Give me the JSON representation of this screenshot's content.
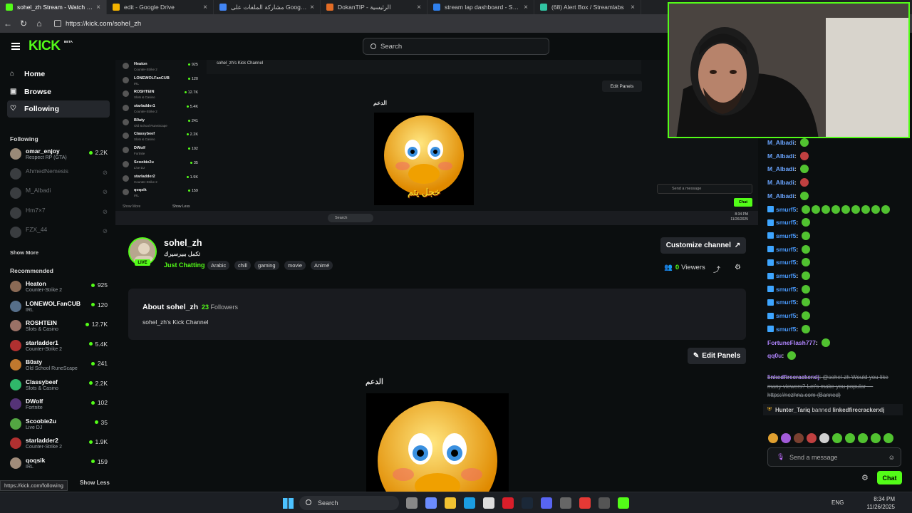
{
  "browser": {
    "tabs": [
      {
        "title": "sohel_zh Stream - Watch Live on",
        "fav": "#53fc18"
      },
      {
        "title": "edit - Google Drive",
        "fav": "#f4b400"
      },
      {
        "title": "مشاركة الملفات على Google Drive",
        "fav": "#4285f4"
      },
      {
        "title": "DokanTIP - الرئيسية",
        "fav": "#e36c25"
      },
      {
        "title": "stream lap dashboard - Search",
        "fav": "#2f80ed"
      },
      {
        "title": "(68) Alert Box / Streamlabs",
        "fav": "#31c3a2"
      }
    ],
    "url": "https://kick.com/sohel_zh",
    "status_url": "https://kick.com/following"
  },
  "header": {
    "logo": "KICK",
    "beta": "BETA",
    "search_placeholder": "Search"
  },
  "sidebar": {
    "nav": [
      "Home",
      "Browse",
      "Following"
    ],
    "following_title": "Following",
    "following": [
      {
        "name": "omar_enjoy",
        "sub": "Respect RP (GTA)",
        "viewers": "2.2K",
        "live": true
      },
      {
        "name": "AhmedNemesis",
        "sub": "",
        "viewers": "",
        "live": false
      },
      {
        "name": "M_Albadi",
        "sub": "",
        "viewers": "",
        "live": false
      },
      {
        "name": "Hm7×7",
        "sub": "",
        "viewers": "",
        "live": false
      },
      {
        "name": "FZX_44",
        "sub": "",
        "viewers": "",
        "live": false
      }
    ],
    "show_more": "Show More",
    "recommended_title": "Recommended",
    "recommended": [
      {
        "name": "Heaton",
        "sub": "Counter-Strike 2",
        "viewers": "925",
        "color": "#8a6a55"
      },
      {
        "name": "LONEWOLFanCUB",
        "sub": "IRL",
        "viewers": "120",
        "color": "#566f8a"
      },
      {
        "name": "ROSHTEIN",
        "sub": "Slots & Casino",
        "viewers": "12.7K",
        "color": "#9a7166"
      },
      {
        "name": "starladder1",
        "sub": "Counter-Strike 2",
        "viewers": "5.4K",
        "color": "#b03030"
      },
      {
        "name": "B0aty",
        "sub": "Old School RuneScape",
        "viewers": "241",
        "color": "#c0782e"
      },
      {
        "name": "Classybeef",
        "sub": "Slots & Casino",
        "viewers": "2.2K",
        "color": "#2fb86a"
      },
      {
        "name": "DWolf",
        "sub": "Fortnite",
        "viewers": "102",
        "color": "#553377"
      },
      {
        "name": "Scoobie2u",
        "sub": "Live DJ",
        "viewers": "35",
        "color": "#53a642"
      },
      {
        "name": "starladder2",
        "sub": "Counter-Strike 2",
        "viewers": "1.9K",
        "color": "#b03030"
      },
      {
        "name": "qoqsik",
        "sub": "IRL",
        "viewers": "159",
        "color": "#a08c7a"
      }
    ],
    "show_less": "Show Less"
  },
  "nested": {
    "channel_label": "sohel_zh's Kick Channel",
    "edit_panels": "Edit Panels",
    "heading": "الدعم",
    "image_text": "خجل يتم",
    "search": "Search",
    "rows": [
      {
        "name": "Heaton",
        "sub": "Counter-Strike 2",
        "viewers": "925"
      },
      {
        "name": "LONEWOLFanCUB",
        "sub": "IRL",
        "viewers": "120"
      },
      {
        "name": "ROSHTEIN",
        "sub": "Slots & Casino",
        "viewers": "12.7K"
      },
      {
        "name": "starladder1",
        "sub": "Counter-Strike 2",
        "viewers": "5.4K"
      },
      {
        "name": "B0aty",
        "sub": "Old School RuneScape",
        "viewers": "241"
      },
      {
        "name": "Classybeef",
        "sub": "Slots & Casino",
        "viewers": "2.2K"
      },
      {
        "name": "DWolf",
        "sub": "Fortnite",
        "viewers": "102"
      },
      {
        "name": "Scoobie2u",
        "sub": "Live DJ",
        "viewers": "35"
      },
      {
        "name": "starladder2",
        "sub": "Counter-Strike 2",
        "viewers": "1.9K"
      },
      {
        "name": "qoqsik",
        "sub": "IRL",
        "viewers": "159"
      }
    ],
    "show_more": "Show More",
    "show_less": "Show Less",
    "chat_placeholder": "Send a message",
    "chat_btn": "Chat",
    "clock": "8:34 PM",
    "date": "11/26/2025"
  },
  "channel": {
    "name": "sohel_zh",
    "title": "تكمل ببيرسيرك",
    "live": "LIVE",
    "category": "Just Chatting",
    "tags": [
      "Arabic",
      "chill",
      "gaming",
      "movie",
      "Animé"
    ],
    "customize": "Customize channel",
    "viewers": "0",
    "viewers_label": "Viewers",
    "about_title": "About sohel_zh",
    "followers_count": "23",
    "followers_label": "Followers",
    "about_desc": "sohel_zh's Kick Channel",
    "edit_panels": "Edit Panels",
    "panel_heading": "الدعم"
  },
  "chat": {
    "messages": [
      {
        "user": "M_Albadi",
        "color": "#6aa5ff",
        "badge": false
      },
      {
        "user": "M_Albadi",
        "color": "#6aa5ff",
        "badge": false
      },
      {
        "user": "M_Albadi",
        "color": "#6aa5ff",
        "badge": false
      },
      {
        "user": "M_Albadi",
        "color": "#6aa5ff",
        "badge": false
      },
      {
        "user": "M_Albadi",
        "color": "#6aa5ff",
        "badge": false
      },
      {
        "user": "smurf5",
        "color": "#4a9bff",
        "badge": true
      },
      {
        "user": "smurf5",
        "color": "#4a9bff",
        "badge": true
      },
      {
        "user": "smurf5",
        "color": "#4a9bff",
        "badge": true
      },
      {
        "user": "smurf5",
        "color": "#4a9bff",
        "badge": true
      },
      {
        "user": "smurf5",
        "color": "#4a9bff",
        "badge": true
      },
      {
        "user": "smurf5",
        "color": "#4a9bff",
        "badge": true
      },
      {
        "user": "smurf5",
        "color": "#4a9bff",
        "badge": true
      },
      {
        "user": "smurf5",
        "color": "#4a9bff",
        "badge": true
      },
      {
        "user": "smurf5",
        "color": "#4a9bff",
        "badge": true
      },
      {
        "user": "smurf5",
        "color": "#4a9bff",
        "badge": true
      },
      {
        "user": "FortuneFlash777",
        "color": "#b185ff",
        "badge": false
      },
      {
        "user": "qq0u",
        "color": "#b185ff",
        "badge": false
      }
    ],
    "spam_user": "linkedfirecrackerxlj",
    "spam_text": "@sohel-zh Would you like many viewers? Let's make you popular — https://nezhna.com",
    "spam_tag": "(Banned)",
    "ban_mod": "Hunter_Tariq",
    "ban_text": "banned",
    "ban_user": "linkedfirecrackerxlj",
    "placeholder": "Send a message",
    "send": "Chat"
  },
  "taskbar": {
    "search": "Search",
    "lang": "ENG",
    "time": "8:34 PM",
    "date": "11/26/2025"
  }
}
